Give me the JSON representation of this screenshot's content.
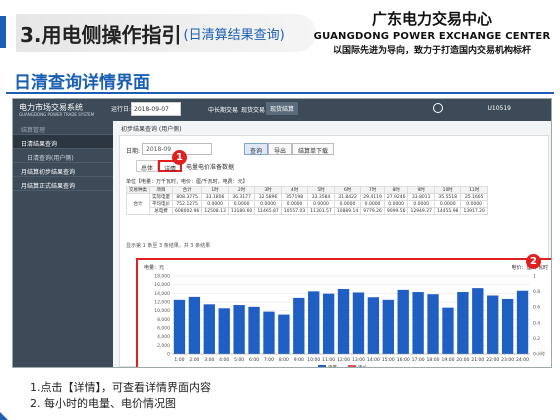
{
  "header": {
    "title": "3.用电侧操作指引",
    "subtitle": "(日清算结果查询)",
    "brand_cn": "广东电力交易中心",
    "brand_en": "GUANGDONG POWER EXCHANGE CENTER",
    "slogan": "以国际先进为导向，致力于打造国内交易机构标杆"
  },
  "section_title": "日清查询详情界面",
  "app": {
    "logo_cn": "电力市场交易系统",
    "logo_en": "GUANGDONG POWER TRADE SYSTEM",
    "date_label": "运行日:",
    "date_value": "2018-09-07",
    "nav": [
      "中长期交易",
      "现货交易",
      "现货结算"
    ],
    "user": "U10519",
    "sidebar": [
      "日清结果查询",
      "日清查询(用户侧)",
      "月结算初步结果查询",
      "月结算正式结果查询"
    ],
    "sidebar_header": "结算管理",
    "crumb": "初步结果查询 (用户侧)",
    "filter_label": "日期:",
    "filter_date": "2018-09",
    "buttons": {
      "query": "查询",
      "export": "导出",
      "download": "结算单下载"
    },
    "tabs": {
      "overview": "总体",
      "detail": "详情",
      "other": "电量电价准备数据"
    },
    "unit_note": "单位【电量：万千瓦时，电价：厘/千瓦时，电费：元】",
    "table_headers": [
      "交易种类",
      "项目",
      "合计",
      "1时",
      "2时",
      "3时",
      "4时",
      "5时",
      "6时",
      "7时",
      "8时",
      "9时",
      "10时",
      "11时"
    ],
    "table_group": "合计",
    "table_rows": [
      [
        "实际电量",
        "808.3775",
        "33.1806",
        "36.3177",
        "32.5896",
        "357198",
        "33.3584",
        "31.8422",
        "29.4119",
        "27.9246",
        "33.8011",
        "35.5518",
        "35.1665"
      ],
      [
        "平均电价",
        "752.1275",
        "0.0000",
        "0.0000",
        "0.0000",
        "0.0000",
        "0.0000",
        "0.0000",
        "0.0000",
        "0.0000",
        "0.0000",
        "0.0000",
        "0.0000"
      ],
      [
        "总电费",
        "608002.96",
        "12508.13",
        "13180.60",
        "11465.87",
        "10557.03",
        "11301.57",
        "10889.14",
        "9779.26",
        "9099.56",
        "12949.27",
        "14455.98",
        "13917.20"
      ]
    ],
    "count_note": "显示第 1 条至 3 条结果，共 3 条结果",
    "badge1": "1",
    "badge2": "2"
  },
  "notes": [
    "1.点击【详情】，可查看详情界面内容",
    "2. 每小时的电量、电价情况图"
  ],
  "colors": {
    "bar": "#1f5fc4",
    "accent": "#e02020",
    "nav": "#3d4a57"
  },
  "chart_data": {
    "type": "bar",
    "left_axis_label": "电量：元",
    "right_axis_label": "电价：厘/千瓦时",
    "left_ticks": [
      "18,000",
      "16,000",
      "14,000",
      "12,000",
      "10,000",
      "8,000",
      "6,000",
      "4,000",
      "2,000",
      "0"
    ],
    "right_ticks": [
      "1",
      "0.8",
      "0.6",
      "0.4",
      "0.2",
      "0小时"
    ],
    "ylim": [
      0,
      18000
    ],
    "categories": [
      "1:00",
      "2:00",
      "3:00",
      "4:00",
      "5:00",
      "6:00",
      "7:00",
      "8:00",
      "9:00",
      "10:00",
      "11:00",
      "12:00",
      "13:00",
      "14:00",
      "15:00",
      "16:00",
      "17:00",
      "18:00",
      "19:00",
      "20:00",
      "21:00",
      "22:00",
      "23:00",
      "24:00"
    ],
    "values": [
      12500,
      13180,
      11465,
      10557,
      11301,
      10889,
      9779,
      9099,
      12949,
      14455,
      13917,
      15000,
      14200,
      13100,
      12500,
      14800,
      14300,
      13800,
      10700,
      14300,
      15200,
      13500,
      12700,
      14600
    ],
    "legend": [
      "电量",
      "电价"
    ]
  }
}
